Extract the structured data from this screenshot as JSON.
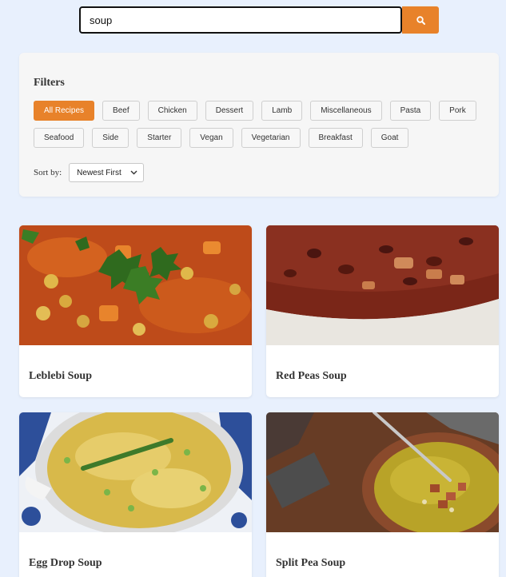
{
  "search": {
    "value": "soup",
    "button_icon": "search-icon"
  },
  "filters": {
    "title": "Filters",
    "categories_row1": [
      "All Recipes",
      "Beef",
      "Chicken",
      "Dessert",
      "Lamb",
      "Miscellaneous",
      "Pasta",
      "Pork"
    ],
    "categories_row2": [
      "Seafood",
      "Side",
      "Starter",
      "Vegan",
      "Vegetarian",
      "Breakfast",
      "Goat"
    ],
    "active_category": "All Recipes",
    "sort_label": "Sort by:",
    "sort_value": "Newest First",
    "accent_color": "#e8822a"
  },
  "recipes": [
    {
      "title": "Leblebi Soup"
    },
    {
      "title": "Red Peas Soup"
    },
    {
      "title": "Egg Drop Soup"
    },
    {
      "title": "Split Pea Soup"
    }
  ]
}
